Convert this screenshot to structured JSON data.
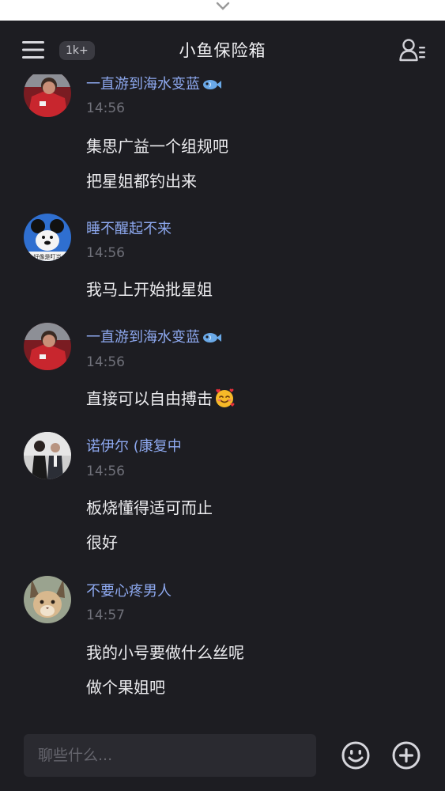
{
  "header": {
    "title": "小鱼保险箱",
    "unread_badge": "1k+"
  },
  "messages": [
    {
      "sender": "一直游到海水变蓝",
      "time": "14:56",
      "lines": [
        "集思广益一个组规吧",
        "把星姐都钓出来"
      ],
      "avatar": "red-jersey-avatar",
      "sender_icon": "fish-icon"
    },
    {
      "sender": "睡不醒起不来",
      "time": "14:56",
      "lines": [
        "我马上开始批星姐"
      ],
      "avatar": "cartoon-mouse-avatar",
      "avatar_caption": "好像是叮当"
    },
    {
      "sender": "一直游到海水变蓝",
      "time": "14:56",
      "lines": [
        "直接可以自由搏击"
      ],
      "avatar": "red-jersey-avatar",
      "sender_icon": "fish-icon",
      "line_emoji": "smiling-face-with-hearts-icon"
    },
    {
      "sender": "诺伊尔 (康复中",
      "time": "14:56",
      "lines": [
        "板烧懂得适可而止",
        "很好"
      ],
      "avatar": "couple-photo-avatar"
    },
    {
      "sender": "不要心疼男人",
      "time": "14:57",
      "lines": [
        "我的小号要做什么丝呢",
        "做个果姐吧"
      ],
      "avatar": "caracal-cat-avatar"
    }
  ],
  "composer": {
    "placeholder": "聊些什么..."
  },
  "colors": {
    "background": "#1d1d22",
    "sender_name": "#8ea9f0",
    "timestamp": "#6f7079",
    "input_bg": "#2a2a30"
  }
}
